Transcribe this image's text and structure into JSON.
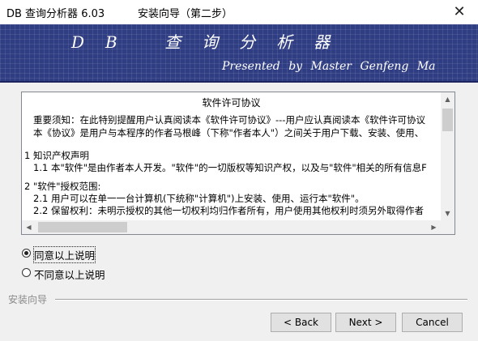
{
  "window": {
    "app_title": "DB 查询分析器 6.03",
    "dialog_title": "安装向导（第二步）",
    "close_label": "✕"
  },
  "banner": {
    "title": "DB 查询分析器",
    "subtitle": "Presented by Master Genfeng Ma"
  },
  "license": {
    "heading": "软件许可协议",
    "lines": [
      "重要须知：在此特别提醒用户认真阅读本《软件许可协议》---用户应认真阅读本《软件许可协议",
      "本《协议》是用户与本程序的作者马根峰（下称\"作者本人\"）之间关于用户下载、安装、使用、",
      "1    知识产权声明",
      "1.1  本\"软件\"是由作者本人开发。\"软件\"的一切版权等知识产权，以及与\"软件\"相关的所有信息F",
      "2    \"软件\"授权范围:",
      "2.1  用户可以在单一一台计算机(下统称\"计算机\")上安装、使用、运行本\"软件\"。",
      "2.2  保留权利：未明示授权的其他一切权利均归作者所有，用户使用其他权利时须另外取得作者"
    ]
  },
  "options": {
    "agree": "同意以上说明",
    "disagree": "不同意以上说明",
    "selected": "agree"
  },
  "group_label": "安装向导",
  "buttons": {
    "back": "< Back",
    "next": "Next >",
    "cancel": "Cancel"
  },
  "icons": {
    "scroll_up": "triangle-up",
    "scroll_down": "triangle-down",
    "scroll_left": "triangle-left",
    "scroll_right": "triangle-right"
  }
}
